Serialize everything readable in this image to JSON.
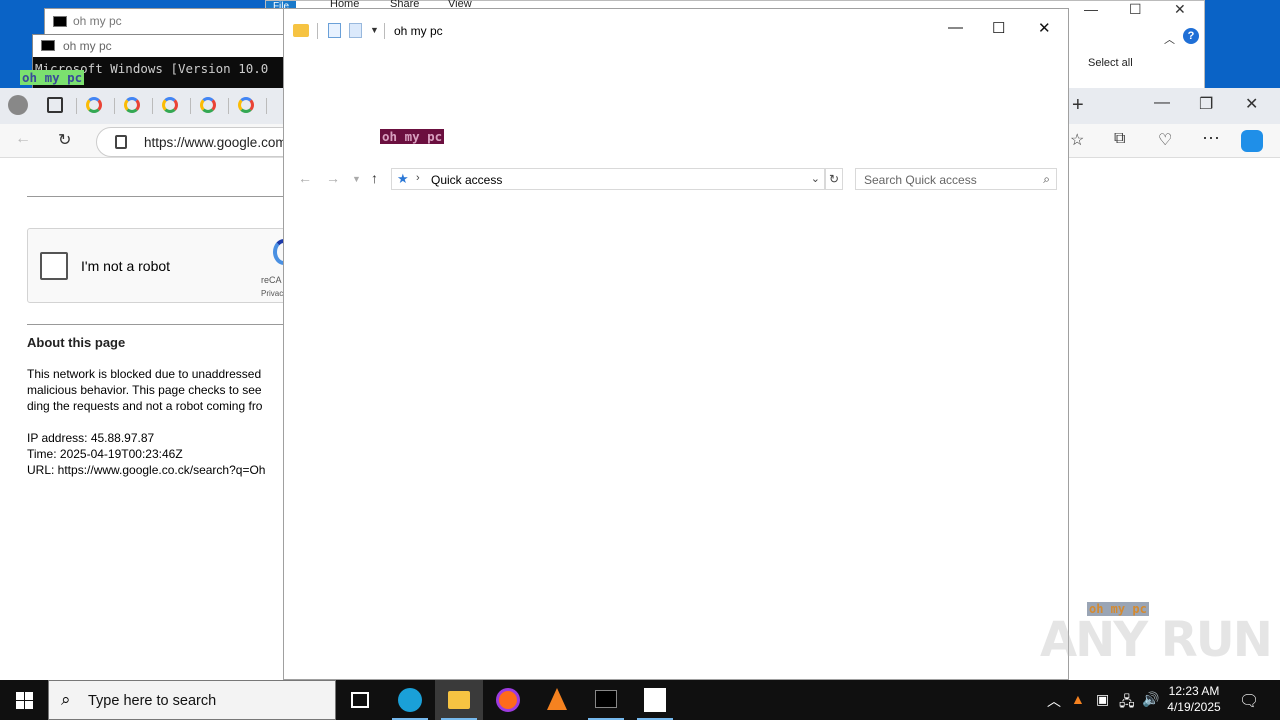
{
  "cmd_windows": {
    "back_title": "oh my pc",
    "front_title": "oh my pc",
    "console_line1": "Microsoft Windows [Version 10.0",
    "highlight": "oh my pc"
  },
  "back_explorer": {
    "tabs": [
      "File",
      "Home",
      "Share",
      "View"
    ],
    "select_all": "Select all",
    "help": "?"
  },
  "browser": {
    "url": "https://www.google.com",
    "page": {
      "recaptcha_label": "I'm not a robot",
      "recaptcha_brand": "reCA",
      "recaptcha_privacy": "Privacy",
      "about_title": "About this page",
      "about_lines": [
        "This network is blocked due to unaddressed",
        "malicious behavior. This page checks to see",
        "ding the requests and not a robot coming fro"
      ],
      "ip_line": "IP address: 45.88.97.87",
      "time_line": "Time: 2025-04-19T00:23:46Z",
      "url_line": "URL: https://www.google.co.ck/search?q=Oh"
    }
  },
  "explorer": {
    "title": "oh my pc",
    "highlight": "oh my pc",
    "address": "Quick access",
    "search_placeholder": "Search Quick access"
  },
  "overlay": {
    "highlight": "oh my pc",
    "watermark": "ANY RUN"
  },
  "taskbar": {
    "search_placeholder": "Type here to search",
    "time": "12:23 AM",
    "date": "4/19/2025",
    "accent": "#76b9ed"
  }
}
